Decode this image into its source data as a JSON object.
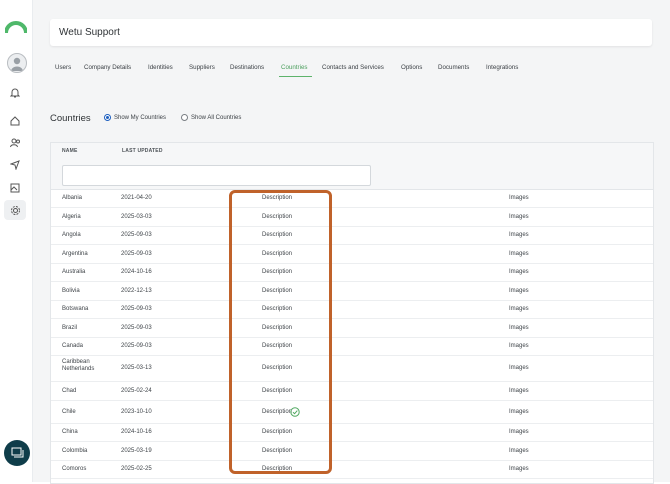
{
  "app": {
    "title": "Wetu Support"
  },
  "nav_icons": [
    {
      "name": "bell-icon"
    },
    {
      "name": "home-icon"
    },
    {
      "name": "users-icon"
    },
    {
      "name": "send-icon"
    },
    {
      "name": "image-icon"
    },
    {
      "name": "gear-icon"
    }
  ],
  "tabs": [
    "Users",
    "Company Details",
    "Identities",
    "Suppliers",
    "Destinations",
    "Countries",
    "Contacts and Services",
    "Options",
    "Documents",
    "Integrations"
  ],
  "active_tab": "Countries",
  "section": {
    "title": "Countries",
    "radio_show_my": "Show My Countries",
    "radio_show_all": "Show All Countries",
    "selected": "Show My Countries"
  },
  "table": {
    "headers": {
      "name": "NAME",
      "updated": "LAST UPDATED"
    },
    "filter_value": "",
    "rows": [
      {
        "name": "Albania",
        "date": "2021-04-20",
        "desc": "Description",
        "images": "Images"
      },
      {
        "name": "Algeria",
        "date": "2025-03-03",
        "desc": "Description",
        "images": "Images"
      },
      {
        "name": "Angola",
        "date": "2025-09-03",
        "desc": "Description",
        "images": "Images"
      },
      {
        "name": "Argentina",
        "date": "2025-09-03",
        "desc": "Description",
        "images": "Images"
      },
      {
        "name": "Australia",
        "date": "2024-10-16",
        "desc": "Description",
        "images": "Images"
      },
      {
        "name": "Bolivia",
        "date": "2022-12-13",
        "desc": "Description",
        "images": "Images"
      },
      {
        "name": "Botswana",
        "date": "2025-09-03",
        "desc": "Description",
        "images": "Images"
      },
      {
        "name": "Brazil",
        "date": "2025-09-03",
        "desc": "Description",
        "images": "Images"
      },
      {
        "name": "Canada",
        "date": "2025-09-03",
        "desc": "Description",
        "images": "Images"
      },
      {
        "name": "Caribbean Netherlands",
        "date": "2025-03-13",
        "desc": "Description",
        "images": "Images"
      },
      {
        "name": "Chad",
        "date": "2025-02-24",
        "desc": "Description",
        "images": "Images"
      },
      {
        "name": "Chile",
        "date": "2023-10-10",
        "desc": "Description",
        "images": "Images",
        "checked": true
      },
      {
        "name": "China",
        "date": "2024-10-16",
        "desc": "Description",
        "images": "Images"
      },
      {
        "name": "Colombia",
        "date": "2025-03-19",
        "desc": "Description",
        "images": "Images"
      },
      {
        "name": "Comoros",
        "date": "2025-02-25",
        "desc": "Description",
        "images": "Images"
      }
    ]
  },
  "colors": {
    "accent": "#5db36b",
    "highlight": "#c0622a",
    "chat_bg": "#0f3d4a",
    "radio": "#1e5fbf"
  }
}
